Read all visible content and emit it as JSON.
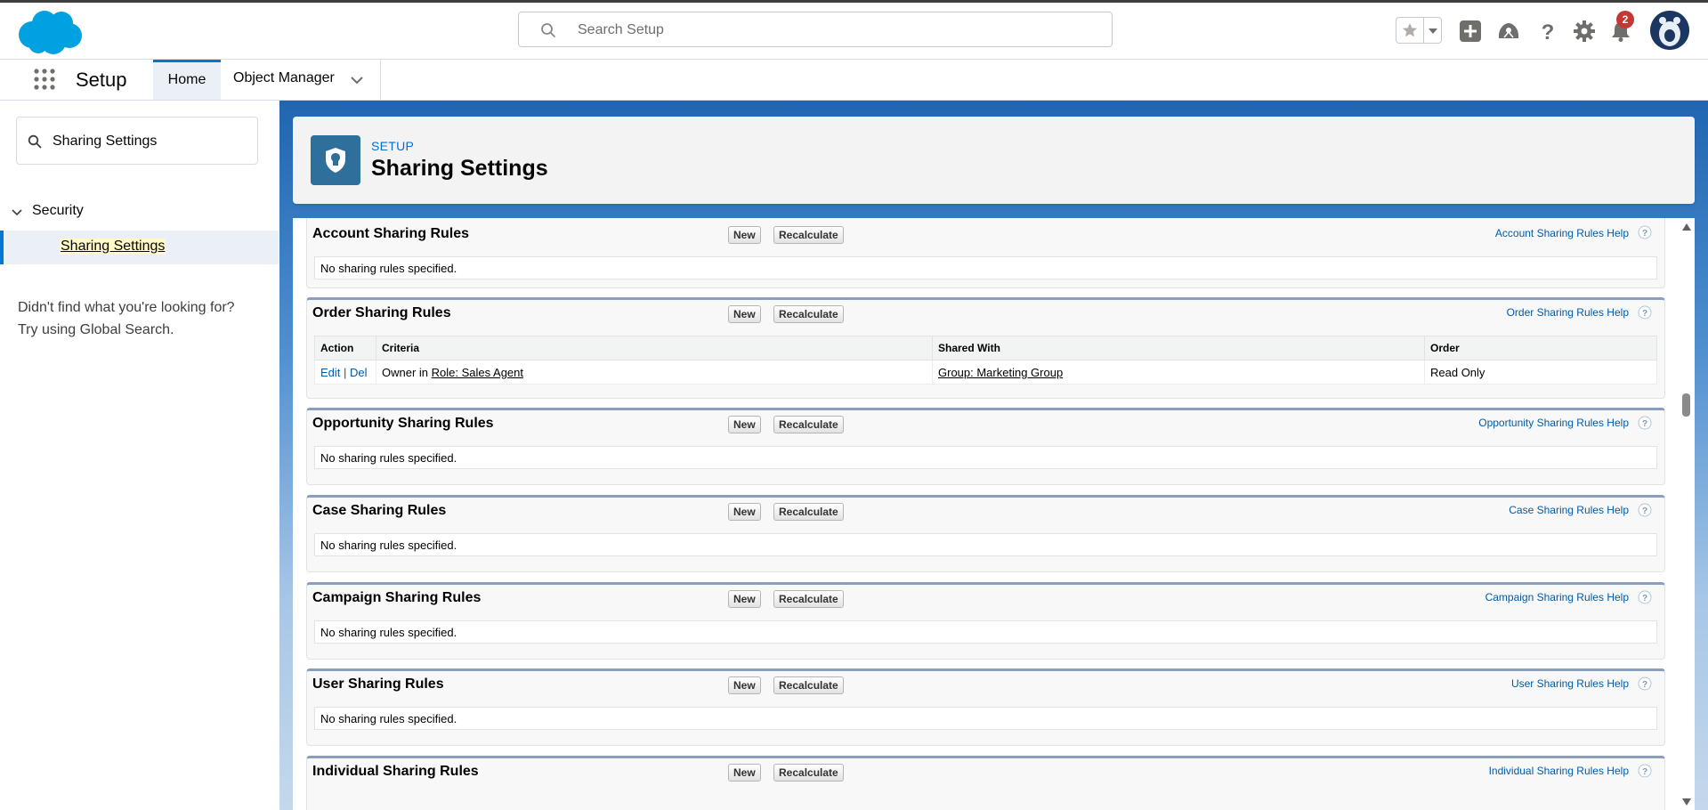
{
  "header": {
    "search_placeholder": "Search Setup",
    "notifications_count": "2"
  },
  "appnav": {
    "title": "Setup",
    "tabs": [
      {
        "label": "Home"
      },
      {
        "label": "Object Manager"
      }
    ]
  },
  "sidebar": {
    "quickfind_value": "Sharing Settings",
    "section_label": "Security",
    "item_label": "Sharing Settings",
    "hint_line1": "Didn't find what you're looking for?",
    "hint_line2": "Try using Global Search."
  },
  "page": {
    "breadcrumb": "SETUP",
    "title": "Sharing Settings"
  },
  "buttons": {
    "new": "New",
    "recalculate": "Recalculate"
  },
  "empty_text": "No sharing rules specified.",
  "sections": [
    {
      "title": "Account Sharing Rules",
      "help": "Account Sharing Rules Help"
    },
    {
      "title": "Order Sharing Rules",
      "help": "Order Sharing Rules Help"
    },
    {
      "title": "Opportunity Sharing Rules",
      "help": "Opportunity Sharing Rules Help"
    },
    {
      "title": "Case Sharing Rules",
      "help": "Case Sharing Rules Help"
    },
    {
      "title": "Campaign Sharing Rules",
      "help": "Campaign Sharing Rules Help"
    },
    {
      "title": "User Sharing Rules",
      "help": "User Sharing Rules Help"
    },
    {
      "title": "Individual Sharing Rules",
      "help": "Individual Sharing Rules Help"
    }
  ],
  "order_table": {
    "columns": [
      "Action",
      "Criteria",
      "Shared With",
      "Order"
    ],
    "row": {
      "edit": "Edit",
      "sep": "|",
      "del": "Del",
      "criteria_prefix": "Owner in",
      "criteria_link": "Role: Sales Agent",
      "shared_with": "Group: Marketing Group",
      "access": "Read Only"
    }
  },
  "colors": {
    "brand_blue": "#0176d3",
    "link_blue": "#015ba7",
    "badge_red": "#c23934",
    "header_icon_bg": "#2e6f9c"
  },
  "icons": [
    "salesforce-cloud-logo",
    "search-icon",
    "star-icon",
    "chevron-down-icon",
    "add-icon",
    "trailhead-icon",
    "help-icon",
    "gear-icon",
    "bell-icon",
    "avatar",
    "waffle-icon",
    "shield-icon"
  ]
}
